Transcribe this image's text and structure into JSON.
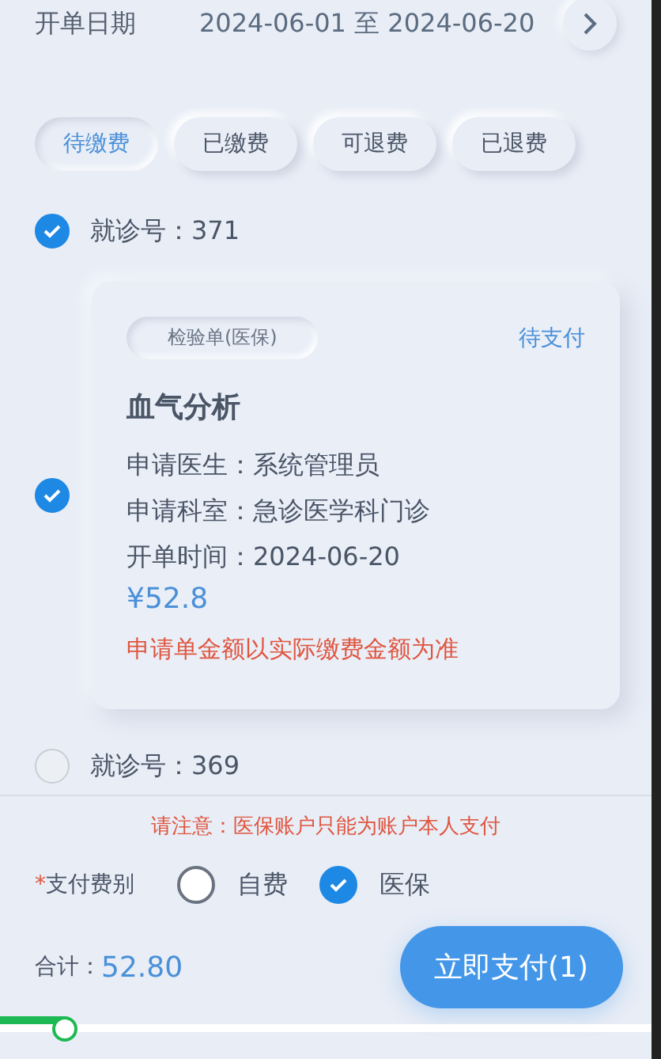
{
  "date_filter": {
    "label": "开单日期",
    "value": "2024-06-01 至 2024-06-20"
  },
  "tabs": [
    {
      "label": "待缴费",
      "selected": true
    },
    {
      "label": "已缴费",
      "selected": false
    },
    {
      "label": "可退费",
      "selected": false
    },
    {
      "label": "已退费",
      "selected": false
    }
  ],
  "visits": [
    {
      "visit_no": "就诊号：371",
      "checked": true,
      "orders": [
        {
          "checked": true,
          "tag": "检验单(医保)",
          "status": "待支付",
          "title": "血气分析",
          "details": [
            "申请医生：系统管理员",
            "申请科室：急诊医学科门诊",
            "开单时间：2024-06-20"
          ],
          "amount": "¥52.8",
          "warning": "申请单金额以实际缴费金额为准"
        }
      ]
    },
    {
      "visit_no": "就诊号：369",
      "checked": false
    }
  ],
  "notice": "请注意：医保账户只能为账户本人支付",
  "payment_type": {
    "required_mark": "*",
    "label": "支付费别",
    "options": [
      {
        "label": "自费",
        "selected": false
      },
      {
        "label": "医保",
        "selected": true
      }
    ]
  },
  "total": {
    "label": "合计：",
    "value": "52.80"
  },
  "pay_button": "立即支付(1)",
  "progress": {
    "level": 0.1
  }
}
